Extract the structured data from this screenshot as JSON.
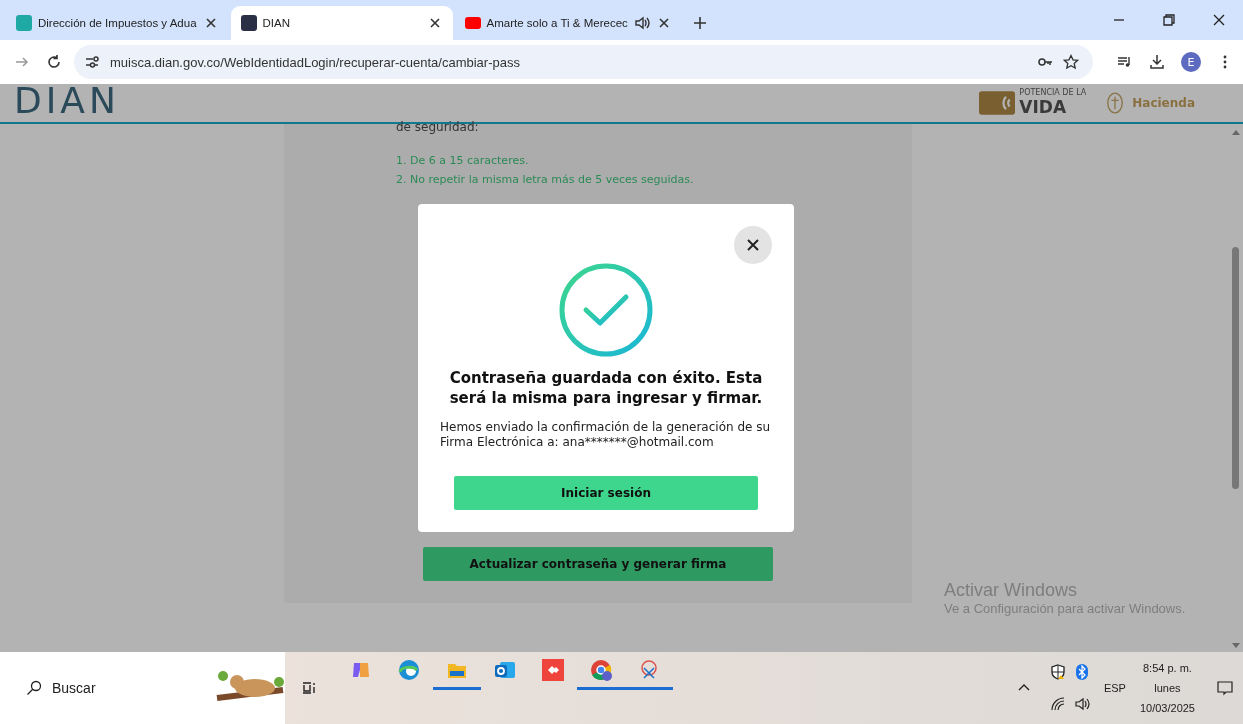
{
  "browser": {
    "tabs": [
      {
        "title": "Dirección de Impuestos y Adua",
        "selected": false,
        "audio": false
      },
      {
        "title": "DIAN",
        "selected": true,
        "audio": false
      },
      {
        "title": "Amarte solo a Ti & Merecec",
        "selected": false,
        "audio": true
      }
    ],
    "url": "muisca.dian.gov.co/WebIdentidadLogin/recuperar-cuenta/cambiar-pass",
    "profile": "E"
  },
  "page": {
    "logo": "DIAN",
    "partner_small": "POTENCIA DE LA",
    "partner_big": "VIDA",
    "ministry": "Hacienda",
    "intro": "de seguridad:",
    "rules": [
      "1. De 6 a 15 caracteres.",
      "2. No repetir la misma letra más de 5 veces seguidas."
    ],
    "submit": "Actualizar contraseña y generar firma"
  },
  "modal": {
    "title": "Contraseña guardada con éxito. Esta será la misma para ingresar y firmar.",
    "message": "Hemos enviado la confirmación de la generación de su Firma Electrónica a: ana*******@hotmail.com",
    "button": "Iniciar sesión"
  },
  "activation": {
    "title": "Activar Windows",
    "message": "Ve a Configuración para activar Windows."
  },
  "taskbar": {
    "search": "Buscar",
    "apps": [
      {
        "kind": "copilot",
        "running": false
      },
      {
        "kind": "edge",
        "running": false
      },
      {
        "kind": "folder",
        "running": true
      },
      {
        "kind": "outlook",
        "running": false
      },
      {
        "kind": "anydesk",
        "running": false
      },
      {
        "kind": "chrome",
        "running": true
      },
      {
        "kind": "snip",
        "running": true
      }
    ],
    "language": "ESP",
    "time": "8:54 p. m.",
    "day": "lunes",
    "date": "10/03/2025"
  }
}
